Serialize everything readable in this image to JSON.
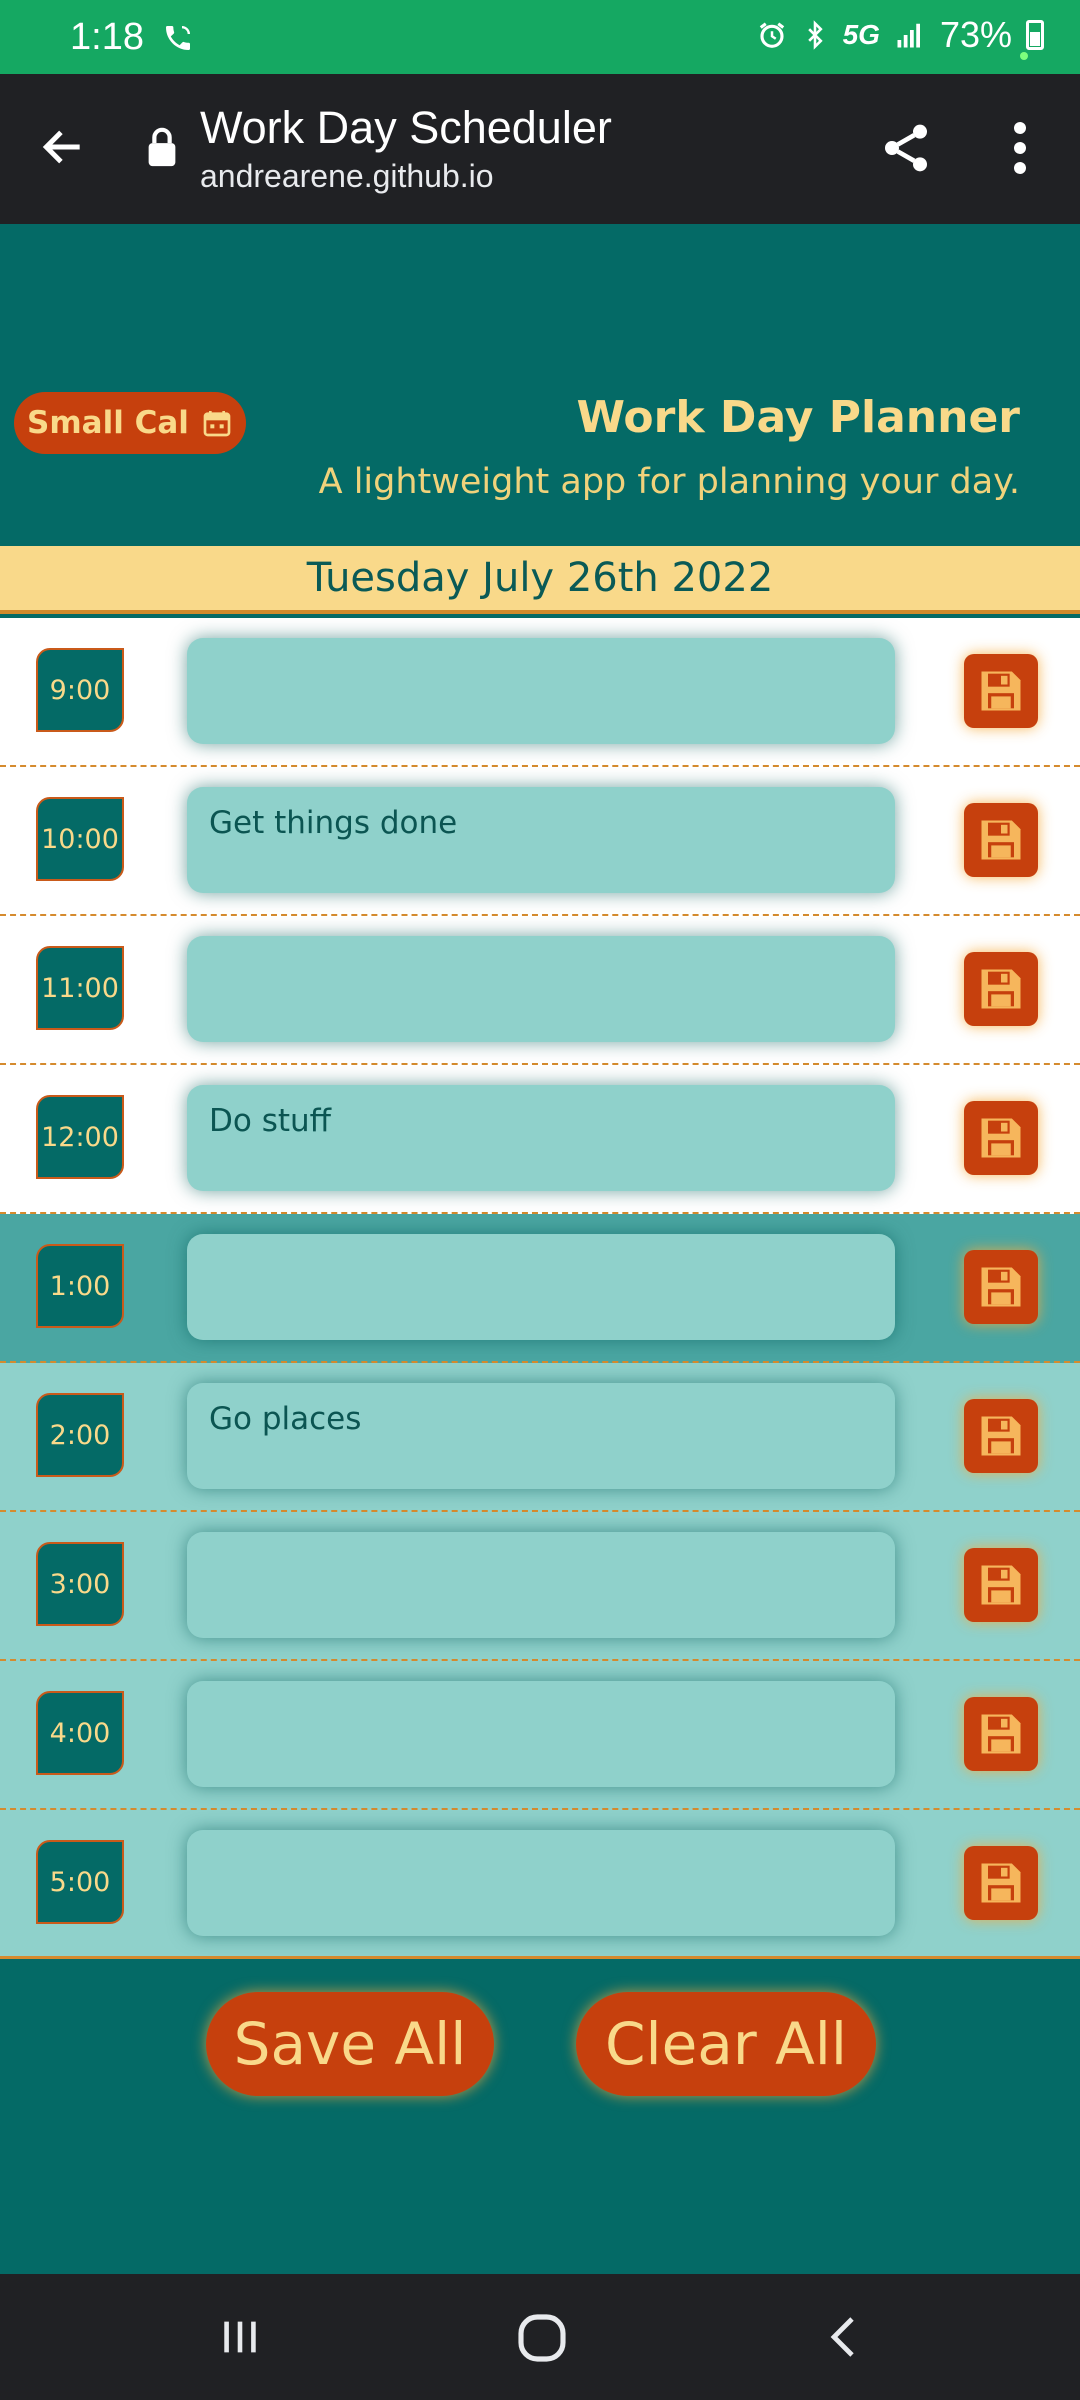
{
  "status_bar": {
    "time": "1:18",
    "network": "5G",
    "battery": "73%"
  },
  "browser": {
    "title": "Work Day Scheduler",
    "url": "andrearene.github.io"
  },
  "header": {
    "small_cal_label": "Small Cal",
    "title": "Work Day Planner",
    "subtitle": "A lightweight app for planning your day."
  },
  "date": "Tuesday July 26th 2022",
  "rows": [
    {
      "hour": "9:00",
      "text": "",
      "state": "past"
    },
    {
      "hour": "10:00",
      "text": "Get things done",
      "state": "past"
    },
    {
      "hour": "11:00",
      "text": "",
      "state": "past"
    },
    {
      "hour": "12:00",
      "text": "Do stuff",
      "state": "past"
    },
    {
      "hour": "1:00",
      "text": "",
      "state": "present"
    },
    {
      "hour": "2:00",
      "text": "Go places",
      "state": "future"
    },
    {
      "hour": "3:00",
      "text": "",
      "state": "future"
    },
    {
      "hour": "4:00",
      "text": "",
      "state": "future"
    },
    {
      "hour": "5:00",
      "text": "",
      "state": "future"
    }
  ],
  "footer": {
    "save_all_label": "Save All",
    "clear_all_label": "Clear All"
  },
  "colors": {
    "teal": "#046a66",
    "accent_orange": "#c6400d",
    "accent_yellow": "#f9d98a",
    "status_green": "#15a862"
  }
}
